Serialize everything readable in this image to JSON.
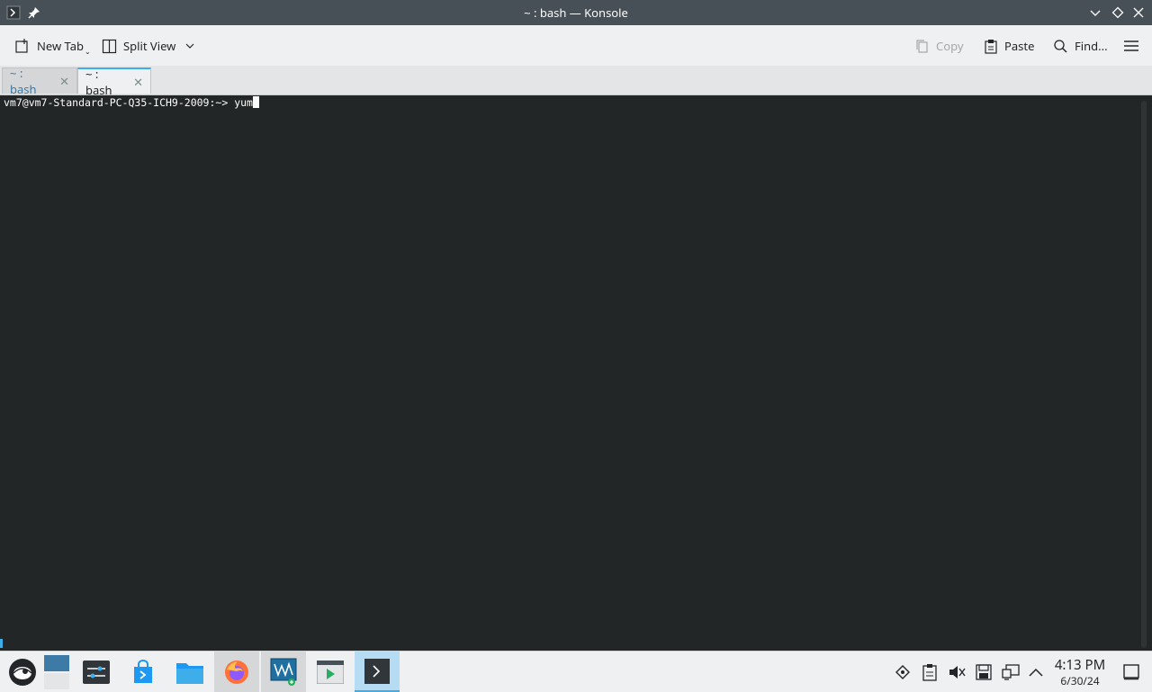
{
  "window": {
    "title": "~ : bash — Konsole"
  },
  "toolbar": {
    "new_tab": "New Tab",
    "split_view": "Split View",
    "copy": "Copy",
    "paste": "Paste",
    "find": "Find..."
  },
  "tabs": [
    {
      "label": "~ : bash",
      "active": false
    },
    {
      "label": "~ : bash",
      "active": true
    }
  ],
  "terminal": {
    "prompt": "vm7@vm7-Standard-PC-Q35-ICH9-2009:~> ",
    "input": "yum"
  },
  "taskbar": {
    "apps": [
      "opensuse-menu-icon",
      "desktop-pager-icon",
      "system-settings-icon",
      "discover-store-icon",
      "file-manager-icon",
      "firefox-icon",
      "vm-manager-icon",
      "media-player-icon",
      "konsole-icon"
    ],
    "clock_time": "4:13 PM",
    "clock_date": "6/30/24"
  },
  "colors": {
    "accent": "#3daee9",
    "terminal_bg": "#232627",
    "titlebar_bg": "#475057"
  }
}
